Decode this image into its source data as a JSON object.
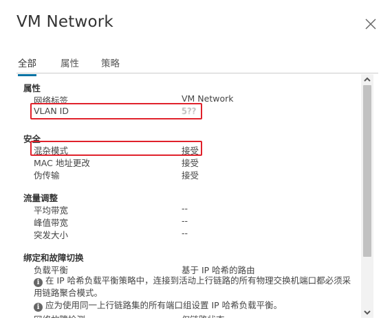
{
  "dialog": {
    "title": "VM Network"
  },
  "tabs": [
    {
      "label": "全部"
    },
    {
      "label": "属性"
    },
    {
      "label": "策略"
    }
  ],
  "properties": {
    "section_title": "属性",
    "network_label": "网络标签",
    "network_value": "VM Network",
    "vlan_label": "VLAN ID",
    "vlan_value": "5??"
  },
  "security": {
    "section_title": "安全",
    "promiscuous_label": "混杂模式",
    "promiscuous_value": "接受",
    "mac_change_label": "MAC 地址更改",
    "mac_change_value": "接受",
    "forged_label": "伪传输",
    "forged_value": "接受"
  },
  "traffic_shaping": {
    "section_title": "流量调整",
    "avg_bandwidth_label": "平均带宽",
    "avg_bandwidth_value": "--",
    "peak_bandwidth_label": "峰值带宽",
    "peak_bandwidth_value": "--",
    "burst_size_label": "突发大小",
    "burst_size_value": "--"
  },
  "teaming": {
    "section_title": "绑定和故障切换",
    "load_balancing_label": "负载平衡",
    "load_balancing_value": "基于 IP 哈希的路由",
    "note1": "在 IP 哈希负载平衡策略中，连接到活动上行链路的所有物理交换机端口都必须采用链路聚合模式。",
    "note2": "应为使用同一上行链路集的所有端口组设置 IP 哈希负载平衡。",
    "failure_detection_label": "网络故障检测",
    "failure_detection_value": "仅链路状态"
  },
  "icons": {
    "close": "close-icon",
    "info": "info-icon",
    "scroll_up": "chevron-up-icon",
    "scroll_down": "chevron-down-icon"
  },
  "colors": {
    "highlight": "#e0202a",
    "tab_active": "#0072a3"
  }
}
